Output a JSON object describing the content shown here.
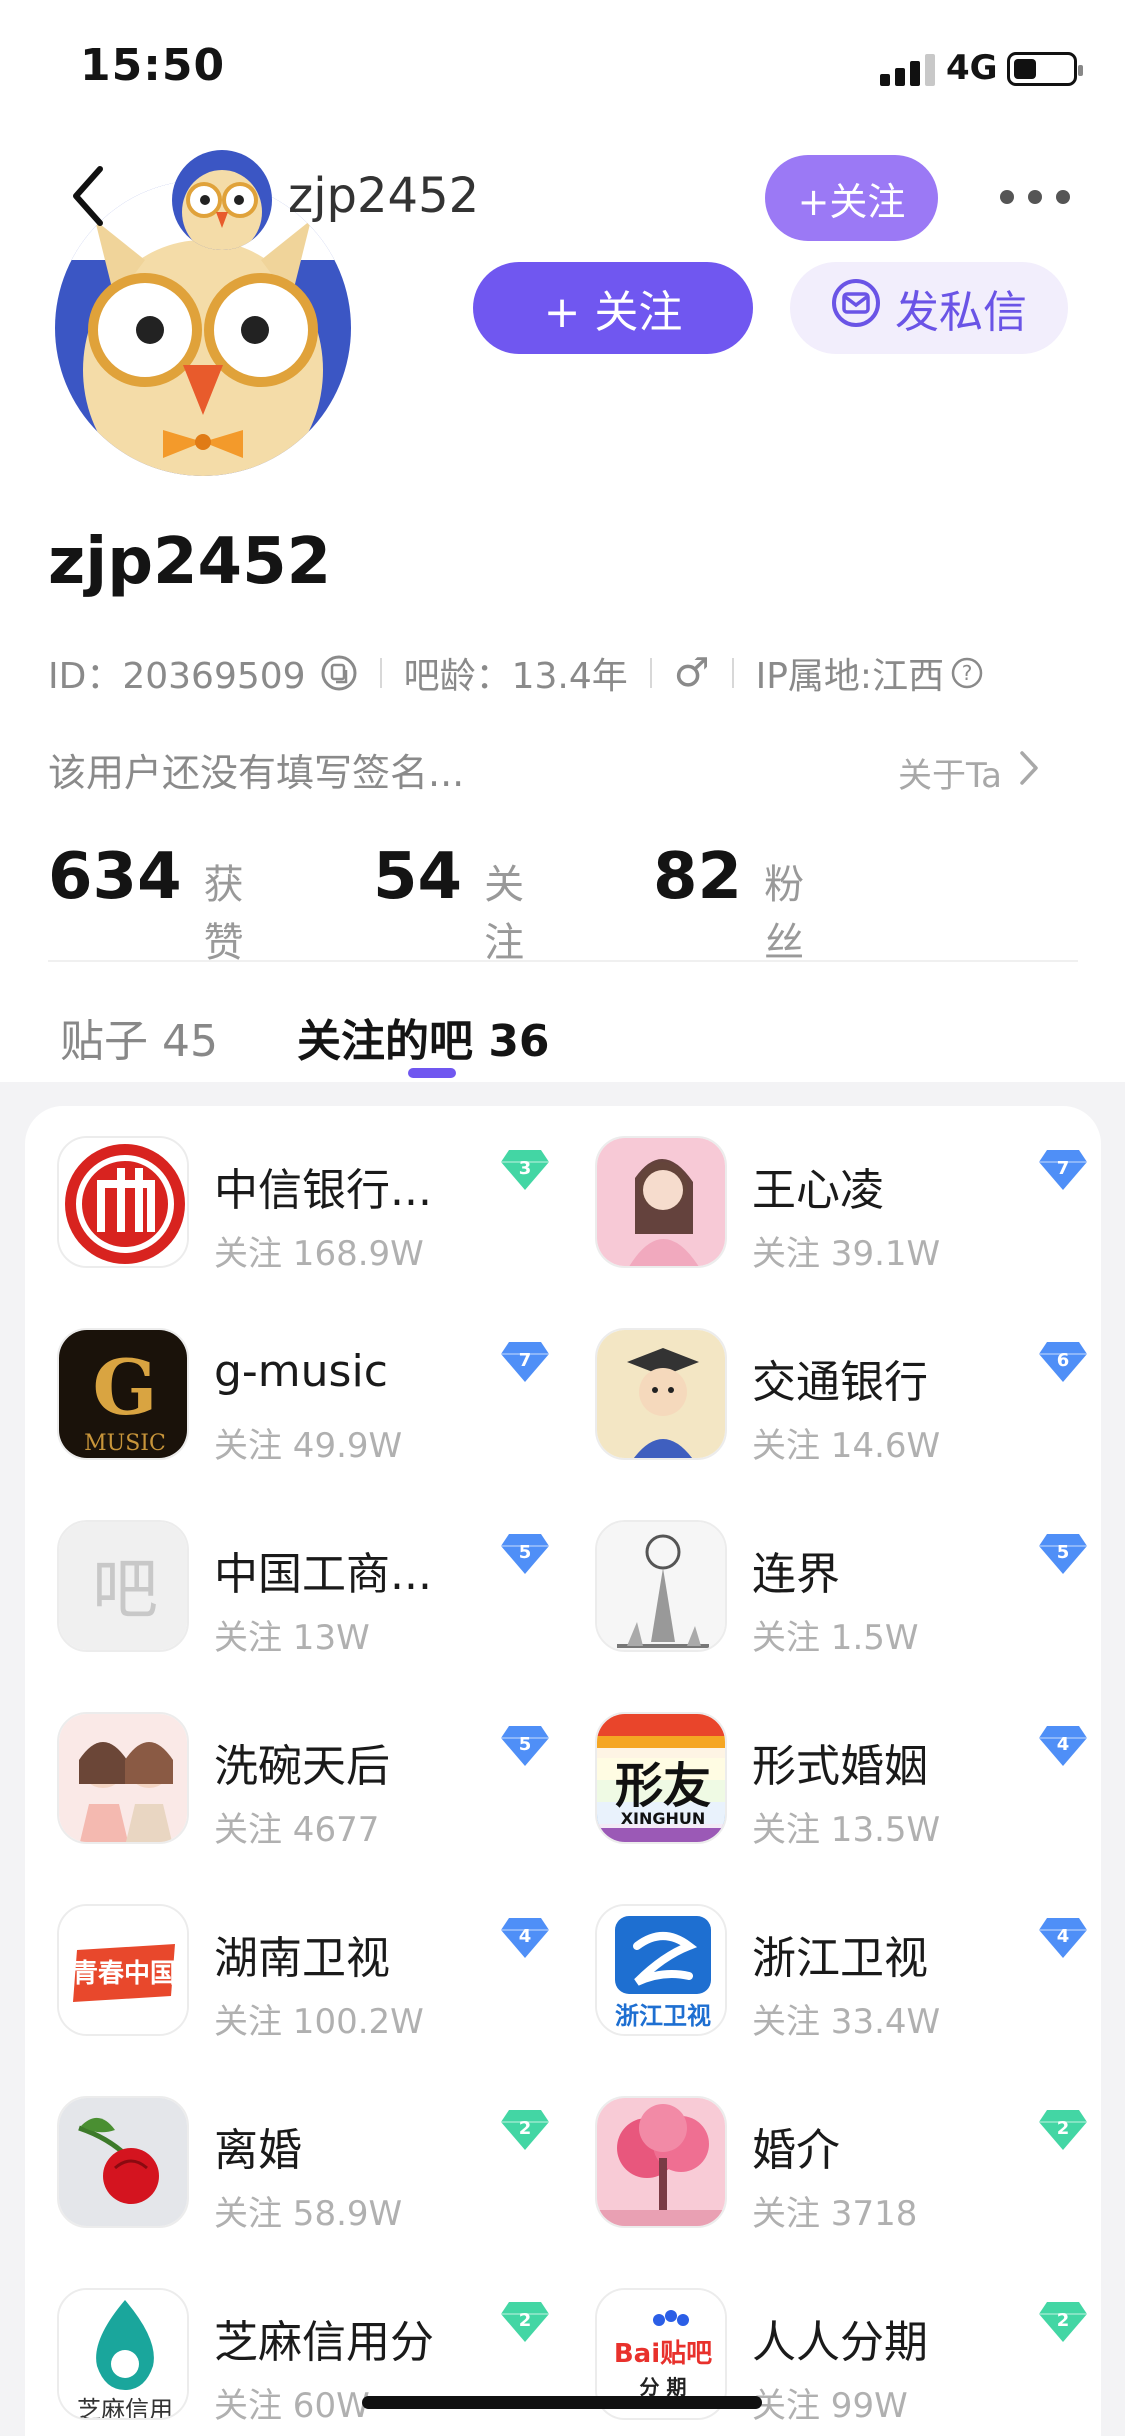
{
  "status_bar": {
    "time": "15:50",
    "network": "4G"
  },
  "header": {
    "name": "zjp2452",
    "follow_label": "+关注"
  },
  "actions": {
    "follow_label": "+ 关注",
    "message_label": "发私信"
  },
  "profile": {
    "username": "zjp2452",
    "id_text": "ID：20369509",
    "age_text": "吧龄：13.4年",
    "gender": "♂",
    "ip_text": "IP属地:江西",
    "signature": "该用户还没有填写签名...",
    "about_label": "关于Ta"
  },
  "stats": [
    {
      "value": "634",
      "label": "获赞"
    },
    {
      "value": "54",
      "label": "关注"
    },
    {
      "value": "82",
      "label": "粉丝"
    }
  ],
  "tabs": [
    {
      "label": "贴子 45"
    },
    {
      "label": "关注的吧 36"
    }
  ],
  "bars": [
    {
      "name": "中信银行...",
      "followers": "关注 168.9W",
      "level": "3",
      "level_color": "#43d6a4"
    },
    {
      "name": "王心凌",
      "followers": "关注 39.1W",
      "level": "7",
      "level_color": "#4f8ff7"
    },
    {
      "name": "g-music",
      "followers": "关注 49.9W",
      "level": "7",
      "level_color": "#4f8ff7"
    },
    {
      "name": "交通银行",
      "followers": "关注 14.6W",
      "level": "6",
      "level_color": "#4f8ff7"
    },
    {
      "name": "中国工商...",
      "followers": "关注 13W",
      "level": "5",
      "level_color": "#4f8ff7"
    },
    {
      "name": "连界",
      "followers": "关注 1.5W",
      "level": "5",
      "level_color": "#4f8ff7"
    },
    {
      "name": "洗碗天后",
      "followers": "关注 4677",
      "level": "5",
      "level_color": "#4f8ff7"
    },
    {
      "name": "形式婚姻",
      "followers": "关注 13.5W",
      "level": "4",
      "level_color": "#4f8ff7"
    },
    {
      "name": "湖南卫视",
      "followers": "关注 100.2W",
      "level": "4",
      "level_color": "#4f8ff7"
    },
    {
      "name": "浙江卫视",
      "followers": "关注 33.4W",
      "level": "4",
      "level_color": "#4f8ff7"
    },
    {
      "name": "离婚",
      "followers": "关注 58.9W",
      "level": "2",
      "level_color": "#43d6a4"
    },
    {
      "name": "婚介",
      "followers": "关注 3718",
      "level": "2",
      "level_color": "#43d6a4"
    },
    {
      "name": "芝麻信用分",
      "followers": "关注 60W",
      "level": "2",
      "level_color": "#43d6a4"
    },
    {
      "name": "人人分期",
      "followers": "关注 99W",
      "level": "2",
      "level_color": "#43d6a4"
    }
  ],
  "logo_text": {
    "placeholder": "吧",
    "gmusic_g": "G",
    "gmusic_word": "MUSIC",
    "xingyou": "形友",
    "xinghun": "XINGHUN",
    "hunan": "青春中国",
    "zhejiang": "浙江卫视",
    "zhima": "芝麻信用",
    "renren_brand": "Bai贴吧",
    "renren_sub": "分 期"
  },
  "colors": {
    "accent": "#7057f0",
    "accent_light": "#9b79f5"
  }
}
